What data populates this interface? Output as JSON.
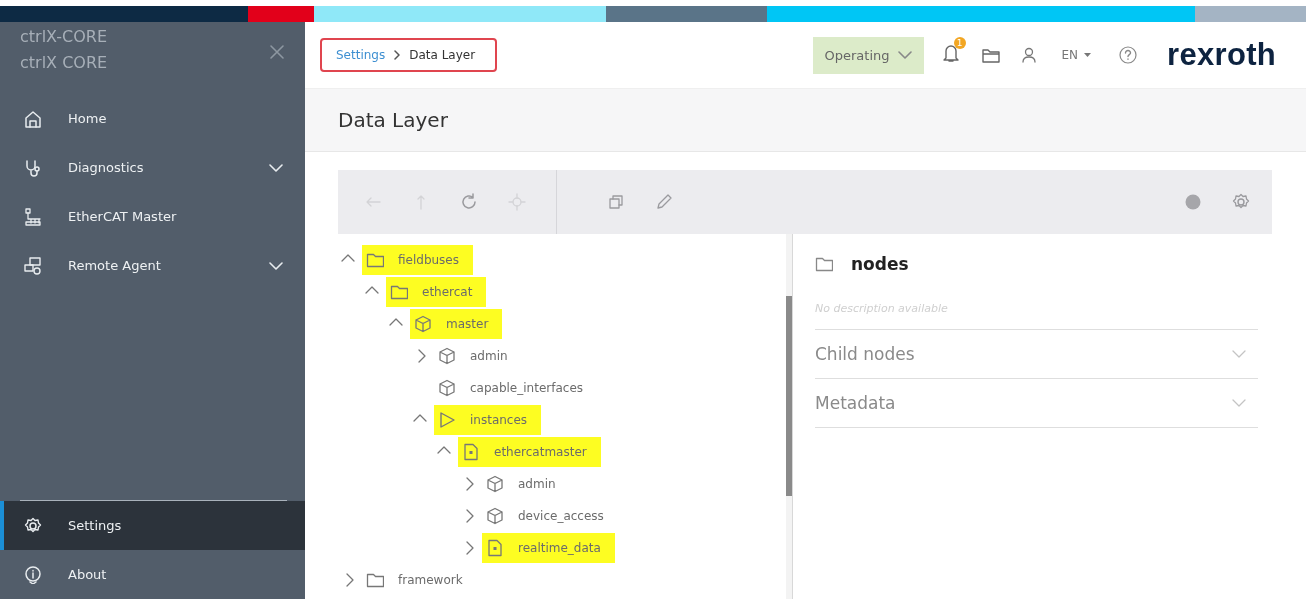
{
  "sidebar": {
    "title_lines": [
      "ctrlX-CORE",
      "ctrlX CORE"
    ],
    "items": [
      {
        "label": "Home",
        "kind": "home",
        "expandable": false,
        "selected": false
      },
      {
        "label": "Diagnostics",
        "kind": "diagnostics",
        "expandable": true,
        "selected": false
      },
      {
        "label": "EtherCAT Master",
        "kind": "network",
        "expandable": false,
        "selected": false
      },
      {
        "label": "Remote Agent",
        "kind": "remote",
        "expandable": true,
        "selected": false
      }
    ],
    "bottom_items": [
      {
        "label": "Settings",
        "kind": "settings",
        "expandable": false,
        "selected": true
      },
      {
        "label": "About",
        "kind": "info",
        "expandable": false,
        "selected": false
      }
    ]
  },
  "header": {
    "breadcrumb": [
      {
        "label": "Settings",
        "kind": "link"
      },
      {
        "label": "Data Layer",
        "kind": "current"
      }
    ],
    "state": "Operating",
    "notification_count": "1",
    "language": "EN",
    "logo": "rexroth"
  },
  "page_title": "Data Layer",
  "toolbar": {
    "navigation": [
      {
        "kind": "back",
        "disabled": true
      },
      {
        "kind": "up",
        "disabled": true
      },
      {
        "kind": "refresh",
        "disabled": false
      },
      {
        "kind": "locate",
        "disabled": true
      }
    ],
    "actions": [
      {
        "kind": "copy",
        "disabled": false
      },
      {
        "kind": "edit",
        "disabled": false
      }
    ],
    "end": [
      {
        "kind": "status",
        "disabled": false
      },
      {
        "kind": "settings",
        "disabled": false
      }
    ]
  },
  "tree": [
    {
      "label": "fieldbuses",
      "kind": "folder",
      "expandable": true,
      "expanded": true,
      "highlighted": true,
      "children": [
        {
          "label": "ethercat",
          "kind": "folder",
          "expandable": true,
          "expanded": true,
          "highlighted": true,
          "children": [
            {
              "label": "master",
              "kind": "cube",
              "expandable": true,
              "expanded": true,
              "highlighted": true,
              "children": [
                {
                  "label": "admin",
                  "kind": "cube",
                  "expandable": true,
                  "expanded": false,
                  "highlighted": false
                },
                {
                  "label": "capable_interfaces",
                  "kind": "cube",
                  "expandable": false,
                  "highlighted": false
                },
                {
                  "label": "instances",
                  "kind": "play",
                  "expandable": true,
                  "expanded": true,
                  "highlighted": true,
                  "children": [
                    {
                      "label": "ethercatmaster",
                      "kind": "file",
                      "expandable": true,
                      "expanded": true,
                      "highlighted": true,
                      "children": [
                        {
                          "label": "admin",
                          "kind": "cube",
                          "expandable": true,
                          "expanded": false,
                          "highlighted": false
                        },
                        {
                          "label": "device_access",
                          "kind": "cube",
                          "expandable": true,
                          "expanded": false,
                          "highlighted": false
                        },
                        {
                          "label": "realtime_data",
                          "kind": "file",
                          "expandable": true,
                          "expanded": false,
                          "highlighted": true
                        }
                      ]
                    }
                  ]
                }
              ]
            }
          ]
        }
      ]
    },
    {
      "label": "framework",
      "kind": "folder",
      "expandable": true,
      "expanded": false,
      "highlighted": false
    }
  ],
  "details": {
    "title": "nodes",
    "kind": "folder",
    "description": "No description available",
    "sections": [
      {
        "label": "Child nodes",
        "expanded": false
      },
      {
        "label": "Metadata",
        "expanded": false
      }
    ]
  }
}
